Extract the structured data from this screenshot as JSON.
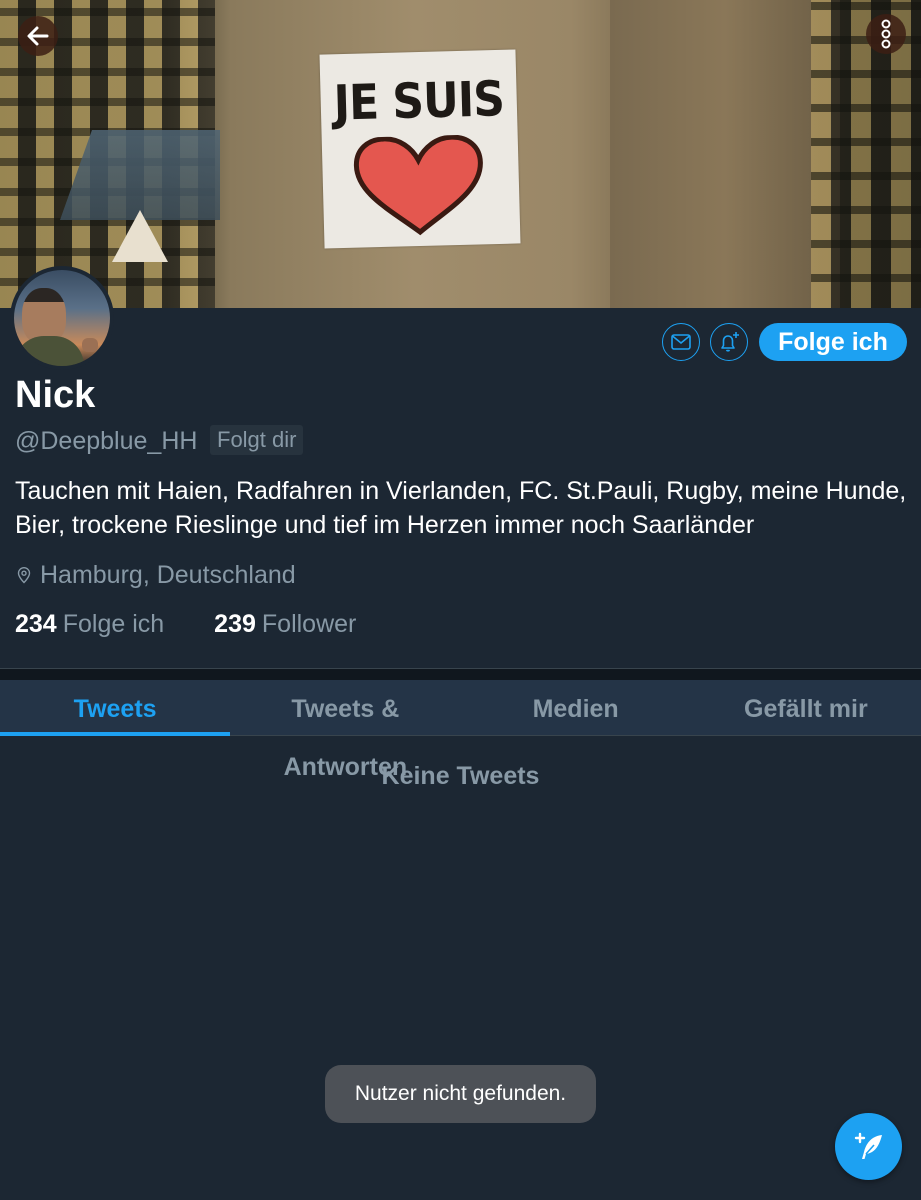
{
  "banner": {
    "poster_text": "JE SUIS"
  },
  "header": {
    "back_icon": "arrow-left-icon",
    "more_icon": "vertical-dots-icon"
  },
  "profile": {
    "name": "Nick",
    "handle": "@Deepblue_HH",
    "follows_you_badge": "Folgt dir",
    "bio": "Tauchen mit Haien, Radfahren in Vierlanden, FC. St.Pauli, Rugby, meine Hunde, Bier, trockene Rieslinge und tief im Herzen immer noch Saarländer",
    "location": "Hamburg, Deutschland",
    "following_count": "234",
    "following_label": "Folge ich",
    "followers_count": "239",
    "followers_label": "Follower"
  },
  "actions": {
    "message_icon": "envelope-icon",
    "notify_icon": "bell-plus-icon",
    "follow_label": "Folge ich"
  },
  "tabs": [
    {
      "label": "Tweets",
      "active": true
    },
    {
      "label": "Tweets & Antworten",
      "active": false
    },
    {
      "label": "Medien",
      "active": false
    },
    {
      "label": "Gefällt mir",
      "active": false
    }
  ],
  "content": {
    "empty_message": "Keine Tweets"
  },
  "toast": {
    "message": "Nutzer nicht gefunden."
  },
  "fab": {
    "icon": "compose-feather-icon"
  },
  "colors": {
    "accent": "#1da1f2",
    "background": "#1c2733",
    "tab_bar": "#243447",
    "secondary_text": "#8899a6"
  }
}
